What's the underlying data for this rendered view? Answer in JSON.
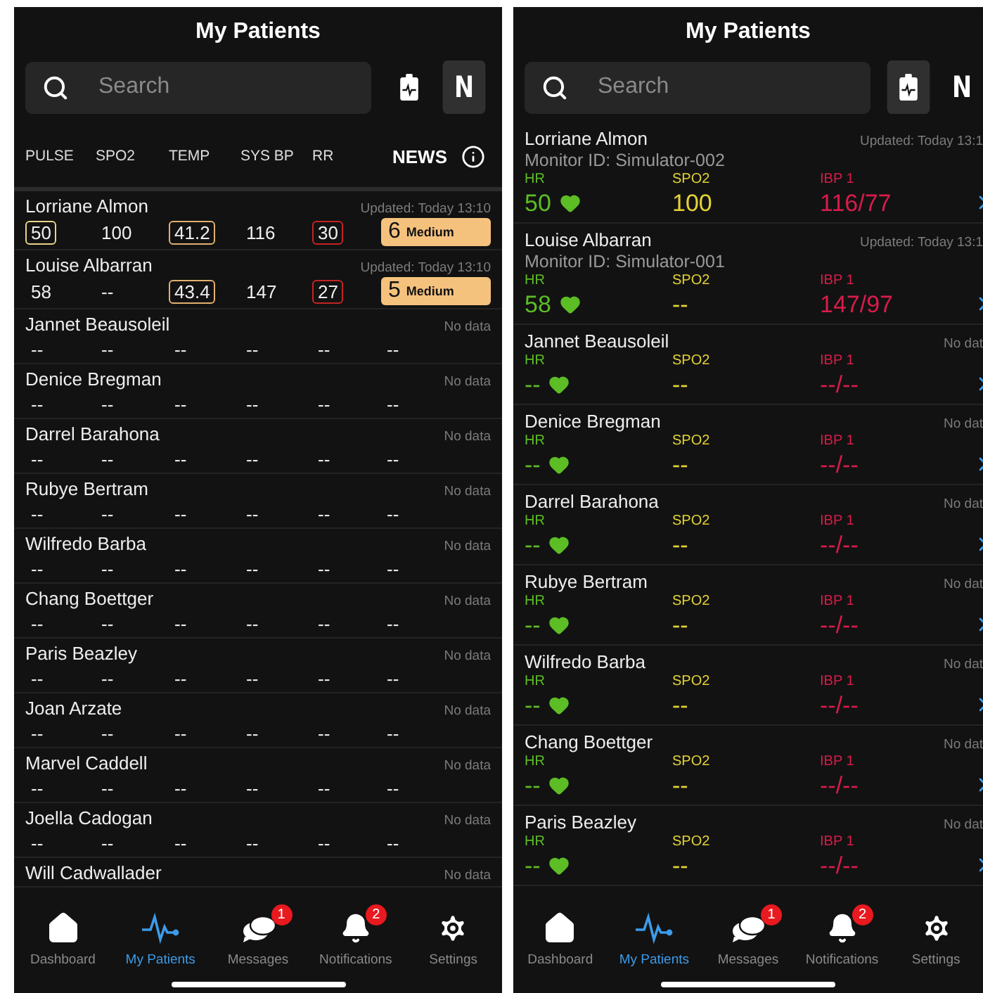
{
  "screens": [
    {
      "kind": "news",
      "title": "My Patients",
      "search": {
        "placeholder": "Search"
      },
      "view_buttons": [
        {
          "kind": "monitor",
          "selected": false
        },
        {
          "kind": "news",
          "label": "N",
          "selected": true
        }
      ],
      "columns": [
        "PULSE",
        "SPO2",
        "TEMP",
        "SYS BP",
        "RR"
      ],
      "news_heading": "NEWS",
      "patients": [
        {
          "name": "Lorriane Almon",
          "updated": "Updated: Today 13:10",
          "values": [
            {
              "text": "50",
              "color": "#e9d488"
            },
            {
              "text": "100"
            },
            {
              "text": "41.2",
              "color": "#e2b06f"
            },
            {
              "text": "116"
            },
            {
              "text": "30",
              "color": "#c42323"
            }
          ],
          "news": {
            "kind": "badge",
            "score": "6",
            "label": "Medium"
          }
        },
        {
          "name": "Louise Albarran",
          "updated": "Updated: Today 13:10",
          "values": [
            {
              "text": "58"
            },
            {
              "text": "--"
            },
            {
              "text": "43.4",
              "color": "#e2b06f"
            },
            {
              "text": "147"
            },
            {
              "text": "27",
              "color": "#c42323"
            }
          ],
          "news": {
            "kind": "badge",
            "score": "5",
            "label": "Medium"
          }
        },
        {
          "name": "Jannet Beausoleil",
          "updated": "No data",
          "values": [
            {
              "text": "--"
            },
            {
              "text": "--"
            },
            {
              "text": "--"
            },
            {
              "text": "--"
            },
            {
              "text": "--"
            }
          ],
          "news": {
            "kind": "empty",
            "score": "--"
          }
        },
        {
          "name": "Denice Bregman",
          "updated": "No data",
          "values": [
            {
              "text": "--"
            },
            {
              "text": "--"
            },
            {
              "text": "--"
            },
            {
              "text": "--"
            },
            {
              "text": "--"
            }
          ],
          "news": {
            "kind": "empty",
            "score": "--"
          }
        },
        {
          "name": "Darrel Barahona",
          "updated": "No data",
          "values": [
            {
              "text": "--"
            },
            {
              "text": "--"
            },
            {
              "text": "--"
            },
            {
              "text": "--"
            },
            {
              "text": "--"
            }
          ],
          "news": {
            "kind": "empty",
            "score": "--"
          }
        },
        {
          "name": "Rubye Bertram",
          "updated": "No data",
          "values": [
            {
              "text": "--"
            },
            {
              "text": "--"
            },
            {
              "text": "--"
            },
            {
              "text": "--"
            },
            {
              "text": "--"
            }
          ],
          "news": {
            "kind": "empty",
            "score": "--"
          }
        },
        {
          "name": "Wilfredo Barba",
          "updated": "No data",
          "values": [
            {
              "text": "--"
            },
            {
              "text": "--"
            },
            {
              "text": "--"
            },
            {
              "text": "--"
            },
            {
              "text": "--"
            }
          ],
          "news": {
            "kind": "empty",
            "score": "--"
          }
        },
        {
          "name": "Chang Boettger",
          "updated": "No data",
          "values": [
            {
              "text": "--"
            },
            {
              "text": "--"
            },
            {
              "text": "--"
            },
            {
              "text": "--"
            },
            {
              "text": "--"
            }
          ],
          "news": {
            "kind": "empty",
            "score": "--"
          }
        },
        {
          "name": "Paris Beazley",
          "updated": "No data",
          "values": [
            {
              "text": "--"
            },
            {
              "text": "--"
            },
            {
              "text": "--"
            },
            {
              "text": "--"
            },
            {
              "text": "--"
            }
          ],
          "news": {
            "kind": "empty",
            "score": "--"
          }
        },
        {
          "name": "Joan Arzate",
          "updated": "No data",
          "values": [
            {
              "text": "--"
            },
            {
              "text": "--"
            },
            {
              "text": "--"
            },
            {
              "text": "--"
            },
            {
              "text": "--"
            }
          ],
          "news": {
            "kind": "empty",
            "score": "--"
          }
        },
        {
          "name": "Marvel Caddell",
          "updated": "No data",
          "values": [
            {
              "text": "--"
            },
            {
              "text": "--"
            },
            {
              "text": "--"
            },
            {
              "text": "--"
            },
            {
              "text": "--"
            }
          ],
          "news": {
            "kind": "empty",
            "score": "--"
          }
        },
        {
          "name": "Joella Cadogan",
          "updated": "No data",
          "values": [
            {
              "text": "--"
            },
            {
              "text": "--"
            },
            {
              "text": "--"
            },
            {
              "text": "--"
            },
            {
              "text": "--"
            }
          ],
          "news": {
            "kind": "empty",
            "score": "--"
          }
        },
        {
          "name": "Will Cadwallader",
          "updated": "No data"
        }
      ],
      "tabs": [
        {
          "kind": "home",
          "label": "Dashboard",
          "selected": false
        },
        {
          "kind": "pulse",
          "label": "My Patients",
          "selected": true
        },
        {
          "kind": "chat",
          "label": "Messages",
          "selected": false,
          "badge": "1"
        },
        {
          "kind": "bell",
          "label": "Notifications",
          "selected": false,
          "badge": "2"
        },
        {
          "kind": "gear",
          "label": "Settings",
          "selected": false
        }
      ]
    },
    {
      "kind": "monitor",
      "title": "My Patients",
      "search": {
        "placeholder": "Search"
      },
      "view_buttons": [
        {
          "kind": "monitor",
          "selected": true
        },
        {
          "kind": "news",
          "label": "N",
          "selected": false
        }
      ],
      "patients": [
        {
          "name": "Lorriane Almon",
          "monitor_id": "Monitor ID: Simulator-002",
          "updated": "Updated: Today 13:1",
          "readings": [
            {
              "kind": "hr",
              "label": "HR",
              "value": "50"
            },
            {
              "kind": "spo2",
              "label": "SPO2",
              "value": "100"
            },
            {
              "kind": "ibp",
              "label": "IBP 1",
              "value": "116/77"
            }
          ]
        },
        {
          "name": "Louise Albarran",
          "monitor_id": "Monitor ID: Simulator-001",
          "updated": "Updated: Today 13:1",
          "readings": [
            {
              "kind": "hr",
              "label": "HR",
              "value": "58"
            },
            {
              "kind": "spo2",
              "label": "SPO2",
              "value": "--"
            },
            {
              "kind": "ibp",
              "label": "IBP 1",
              "value": "147/97"
            }
          ]
        },
        {
          "name": "Jannet Beausoleil",
          "updated": "No dat",
          "readings": [
            {
              "kind": "hr",
              "label": "HR",
              "value": "--"
            },
            {
              "kind": "spo2",
              "label": "SPO2",
              "value": "--"
            },
            {
              "kind": "ibp",
              "label": "IBP 1",
              "value": "--/--"
            }
          ]
        },
        {
          "name": "Denice Bregman",
          "updated": "No dat",
          "readings": [
            {
              "kind": "hr",
              "label": "HR",
              "value": "--"
            },
            {
              "kind": "spo2",
              "label": "SPO2",
              "value": "--"
            },
            {
              "kind": "ibp",
              "label": "IBP 1",
              "value": "--/--"
            }
          ]
        },
        {
          "name": "Darrel Barahona",
          "updated": "No dat",
          "readings": [
            {
              "kind": "hr",
              "label": "HR",
              "value": "--"
            },
            {
              "kind": "spo2",
              "label": "SPO2",
              "value": "--"
            },
            {
              "kind": "ibp",
              "label": "IBP 1",
              "value": "--/--"
            }
          ]
        },
        {
          "name": "Rubye Bertram",
          "updated": "No dat",
          "readings": [
            {
              "kind": "hr",
              "label": "HR",
              "value": "--"
            },
            {
              "kind": "spo2",
              "label": "SPO2",
              "value": "--"
            },
            {
              "kind": "ibp",
              "label": "IBP 1",
              "value": "--/--"
            }
          ]
        },
        {
          "name": "Wilfredo Barba",
          "updated": "No dat",
          "readings": [
            {
              "kind": "hr",
              "label": "HR",
              "value": "--"
            },
            {
              "kind": "spo2",
              "label": "SPO2",
              "value": "--"
            },
            {
              "kind": "ibp",
              "label": "IBP 1",
              "value": "--/--"
            }
          ]
        },
        {
          "name": "Chang Boettger",
          "updated": "No dat",
          "readings": [
            {
              "kind": "hr",
              "label": "HR",
              "value": "--"
            },
            {
              "kind": "spo2",
              "label": "SPO2",
              "value": "--"
            },
            {
              "kind": "ibp",
              "label": "IBP 1",
              "value": "--/--"
            }
          ]
        },
        {
          "name": "Paris Beazley",
          "updated": "No dat",
          "readings": [
            {
              "kind": "hr",
              "label": "HR",
              "value": "--"
            },
            {
              "kind": "spo2",
              "label": "SPO2",
              "value": "--"
            },
            {
              "kind": "ibp",
              "label": "IBP 1",
              "value": "--/--"
            }
          ]
        }
      ],
      "tabs": [
        {
          "kind": "home",
          "label": "Dashboard",
          "selected": false
        },
        {
          "kind": "pulse",
          "label": "My Patients",
          "selected": true
        },
        {
          "kind": "chat",
          "label": "Messages",
          "selected": false,
          "badge": "1"
        },
        {
          "kind": "bell",
          "label": "Notifications",
          "selected": false,
          "badge": "2"
        },
        {
          "kind": "gear",
          "label": "Settings",
          "selected": false
        }
      ]
    }
  ]
}
